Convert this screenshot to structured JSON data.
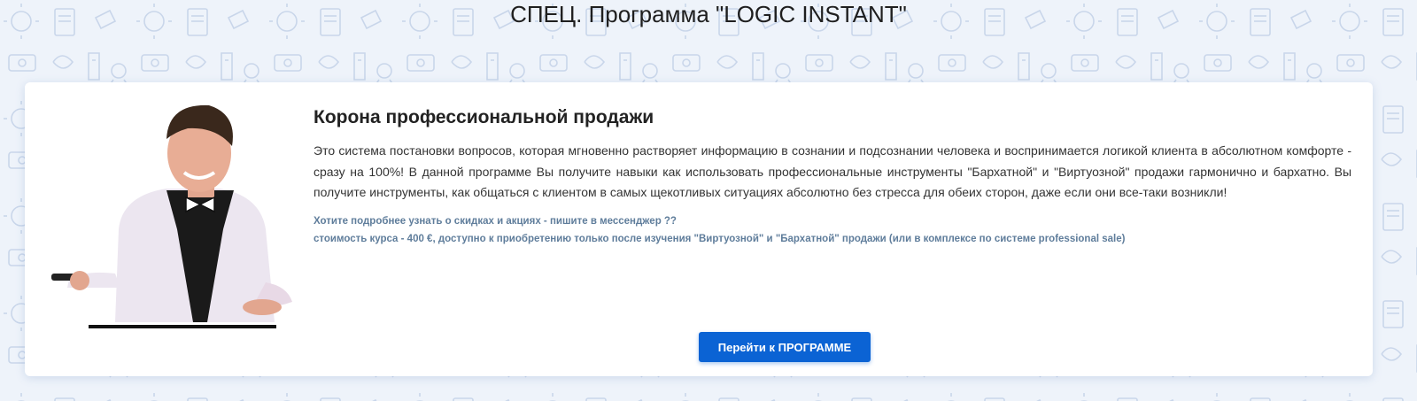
{
  "section": {
    "title": "СПЕЦ. Программа \"LOGIC INSTANT\""
  },
  "card": {
    "title": "Корона профессиональной продажи",
    "description": "Это система постановки вопросов, которая мгновенно растворяет информацию в сознании и подсознании человека и воспринимается логикой клиента в абсолютном комфорте - сразу на 100%! В данной программе Вы получите навыки как использовать профессиональные инструменты \"Бархатной\" и \"Виртуозной\" продажи гармонично и бархатно. Вы получите инструменты, как общаться с клиентом в самых щекотливых ситуациях абсолютно без стресса для обеих сторон, даже если они все-таки возникли!",
    "promo_line1": "Хотите подробнее узнать о скидках и акциях - пишите в мессенджер ??",
    "promo_line2": "стоимость курса - 400 €, доступно к приобретению только после изучения \"Виртуозной\" и \"Бархатной\" продажи (или в комплексе по системе professional sale)",
    "button_label": "Перейти к ПРОГРАММЕ"
  },
  "colors": {
    "accent": "#0b63d4",
    "promo_text": "#5f7d9b",
    "background": "#eef3fa"
  },
  "icons": {
    "background": "doodle-pattern-icon",
    "photo": "presenter-photo-icon"
  }
}
